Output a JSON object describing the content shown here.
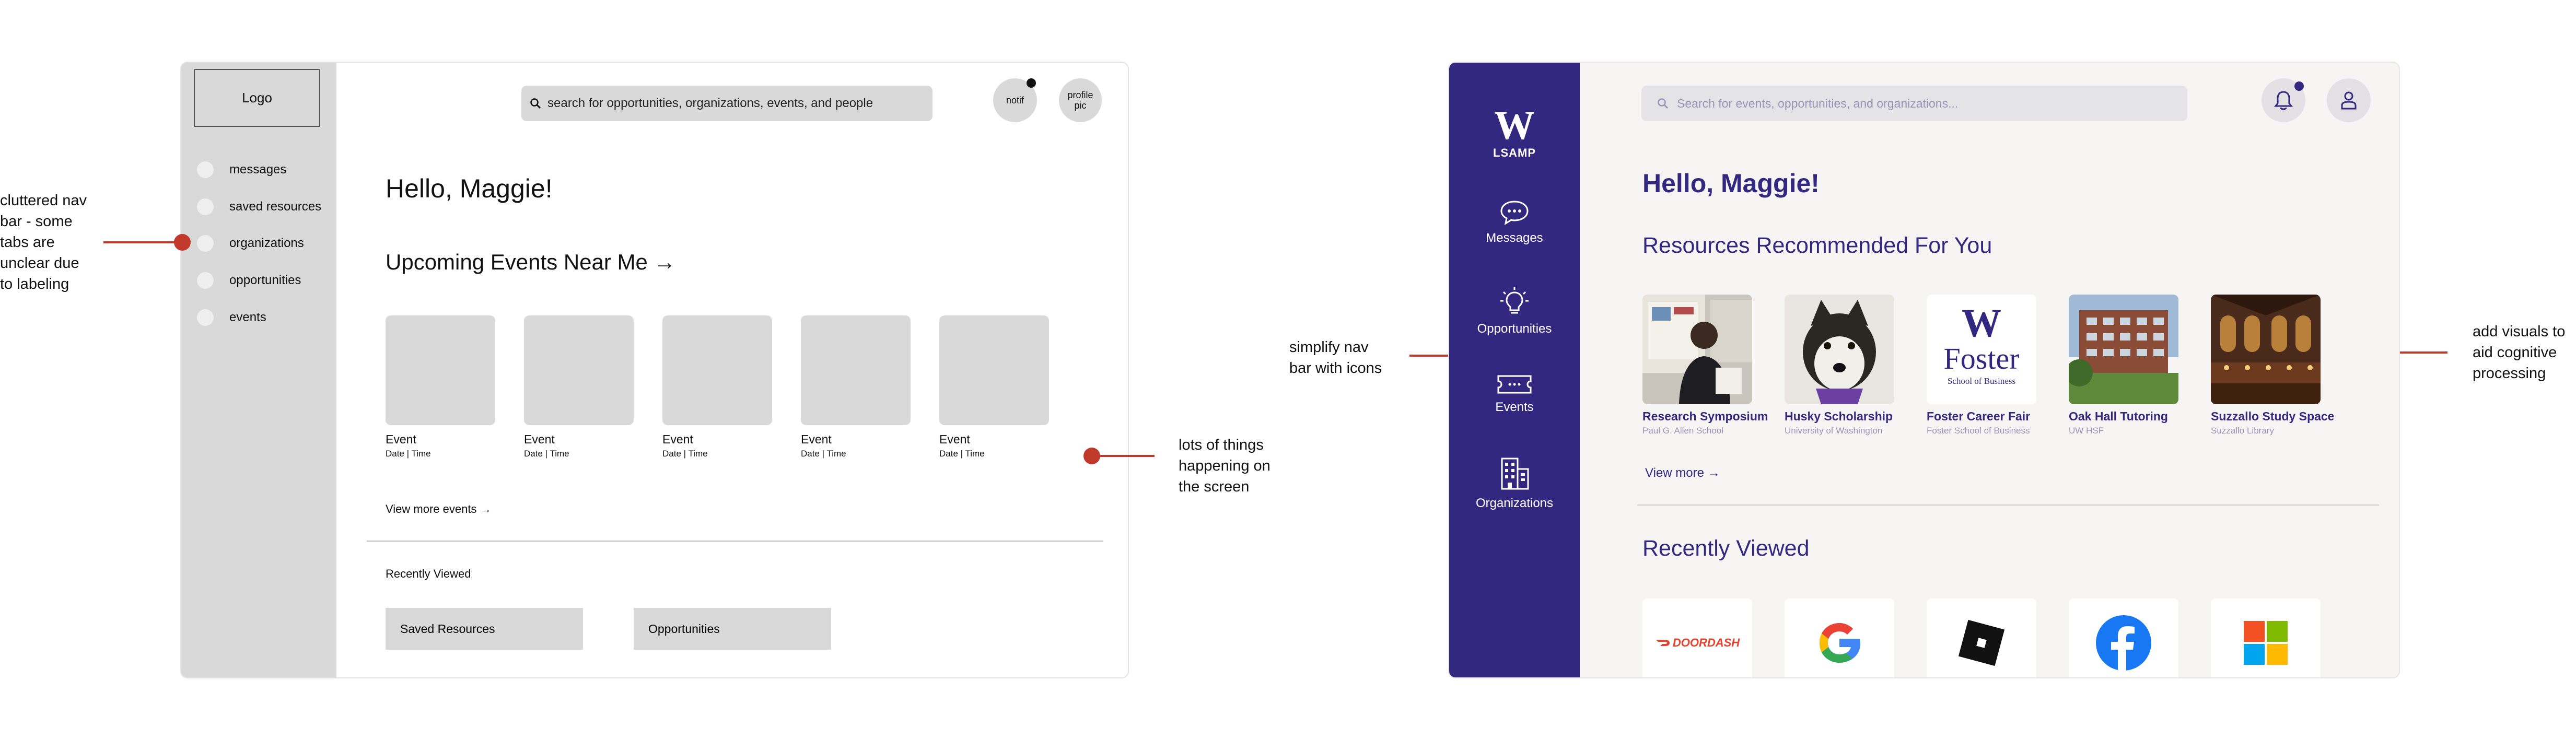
{
  "wireframe": {
    "logo": "Logo",
    "nav": [
      "messages",
      "saved resources",
      "organizations",
      "opportunities",
      "events"
    ],
    "search_placeholder": "search for opportunities, organizations, events, and people",
    "notif_label": "notif",
    "profile_label": "profile pic",
    "greeting": "Hello, Maggie!",
    "upcoming_title": "Upcoming Events Near Me →",
    "events": [
      {
        "title": "Event",
        "meta": "Date | Time"
      },
      {
        "title": "Event",
        "meta": "Date | Time"
      },
      {
        "title": "Event",
        "meta": "Date | Time"
      },
      {
        "title": "Event",
        "meta": "Date | Time"
      },
      {
        "title": "Event",
        "meta": "Date | Time"
      }
    ],
    "view_more": "View more events →",
    "recently_viewed": "Recently Viewed",
    "recent_buttons": [
      "Saved Resources",
      "Opportunities"
    ]
  },
  "annotations": {
    "nav_clutter": [
      "cluttered nav",
      "bar - some",
      "tabs are",
      "unclear due",
      "to labeling"
    ],
    "screen_busy": [
      "lots of things",
      "happening on",
      "the screen"
    ],
    "nav_icons": [
      "simplify nav",
      "bar with icons"
    ],
    "visuals": [
      "add visuals to",
      "aid cognitive",
      "processing"
    ]
  },
  "design": {
    "brand_letter": "W",
    "brand_name": "LSAMP",
    "nav": [
      {
        "label": "Messages",
        "icon": "chat-bubble-icon"
      },
      {
        "label": "Opportunities",
        "icon": "lightbulb-icon"
      },
      {
        "label": "Events",
        "icon": "ticket-icon"
      },
      {
        "label": "Organizations",
        "icon": "building-icon"
      }
    ],
    "search_placeholder": "Search for events, opportunities, and organizations...",
    "greeting": "Hello, Maggie!",
    "resources_title": "Resources Recommended  For You",
    "resources": [
      {
        "name": "Research Symposium",
        "source": "Paul G. Allen School"
      },
      {
        "name": "Husky Scholarship",
        "source": "University of Washington"
      },
      {
        "name": "Foster Career Fair",
        "source": "Foster School of Business"
      },
      {
        "name": "Oak Hall Tutoring",
        "source": "UW HSF"
      },
      {
        "name": "Suzzallo Study Space",
        "source": "Suzzallo Library"
      }
    ],
    "foster_logo_letter": "W",
    "foster_logo_word": "Foster",
    "foster_logo_sub": "School of Business",
    "view_more": "View more  →",
    "recently_viewed": "Recently Viewed",
    "recent_logos": [
      "doordash-logo",
      "google-logo",
      "roblox-logo",
      "facebook-logo",
      "microsoft-logo"
    ],
    "doordash_text": "DOORDASH",
    "colors": {
      "primary": "#33287f",
      "muted": "#9a94b8",
      "background": "#f6f5f3",
      "annotation": "#c0392b"
    }
  }
}
